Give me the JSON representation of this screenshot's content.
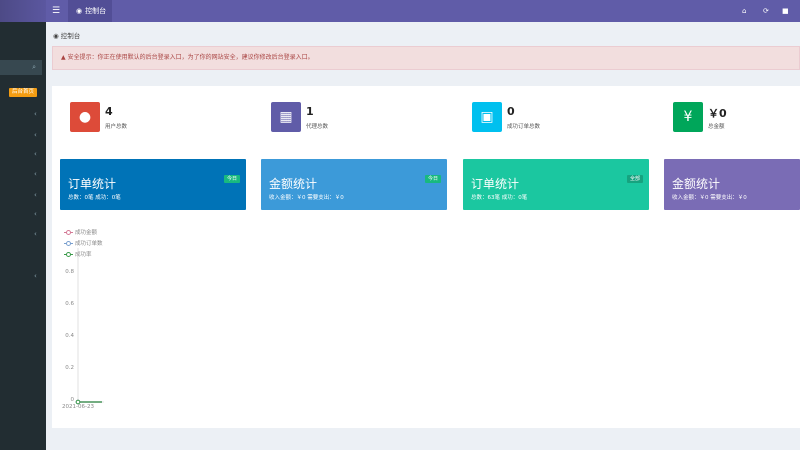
{
  "topbar": {
    "menu_icon": "hamburger-icon",
    "tab_label": "控制台",
    "tab_icon": "dashboard-icon",
    "right_icons": [
      "home-icon",
      "refresh-icon",
      "trash-icon"
    ]
  },
  "sidebar": {
    "home_badge": "后台首页",
    "chevron_count": 8
  },
  "breadcrumb": "控制台",
  "alert": {
    "text": "安全提示：你正在使用默认的后台登录入口，为了你的网站安全，建议你修改后台登录入口。"
  },
  "info_boxes": [
    {
      "value": "4",
      "label": "用户总数",
      "color": "#dd4b39",
      "icon": "users-icon"
    },
    {
      "value": "1",
      "label": "代理总数",
      "color": "#605ca8",
      "icon": "id-card-icon"
    },
    {
      "value": "0",
      "label": "成功订单总数",
      "color": "#00c0ef",
      "icon": "shopping-bag-icon"
    },
    {
      "value": "￥0",
      "label": "总金额",
      "color": "#00a65a",
      "icon": "yen-icon"
    }
  ],
  "stat_boxes": [
    {
      "title": "订单统计",
      "badge": "今日",
      "sub": "总数：0笔  成功：0笔",
      "color": "#0073b7"
    },
    {
      "title": "金额统计",
      "badge": "今日",
      "sub": "收入金额：￥0  需要支出：￥0",
      "color": "#3c9ad9"
    },
    {
      "title": "订单统计",
      "badge": "全部",
      "sub": "总数：63笔  成功：0笔",
      "color": "#1bc7a0"
    },
    {
      "title": "金额统计",
      "badge": "",
      "sub": "收入金额：￥0  需要支出：￥0",
      "color": "#7a6cb5"
    }
  ],
  "chart_data": {
    "type": "line",
    "x": [
      "2021-06-23"
    ],
    "series": [
      {
        "name": "成功金额",
        "values": [
          0
        ],
        "color": "#d47a96"
      },
      {
        "name": "成功订单数",
        "values": [
          0
        ],
        "color": "#7aa0cf"
      },
      {
        "name": "成功率",
        "values": [
          0
        ],
        "color": "#3a9a4a"
      }
    ],
    "y_ticks": [
      "0.8",
      "0.6",
      "0.4",
      "0.2",
      "0"
    ],
    "ylim": [
      0,
      0.8
    ],
    "grid": false,
    "legend_position": "top-left"
  }
}
